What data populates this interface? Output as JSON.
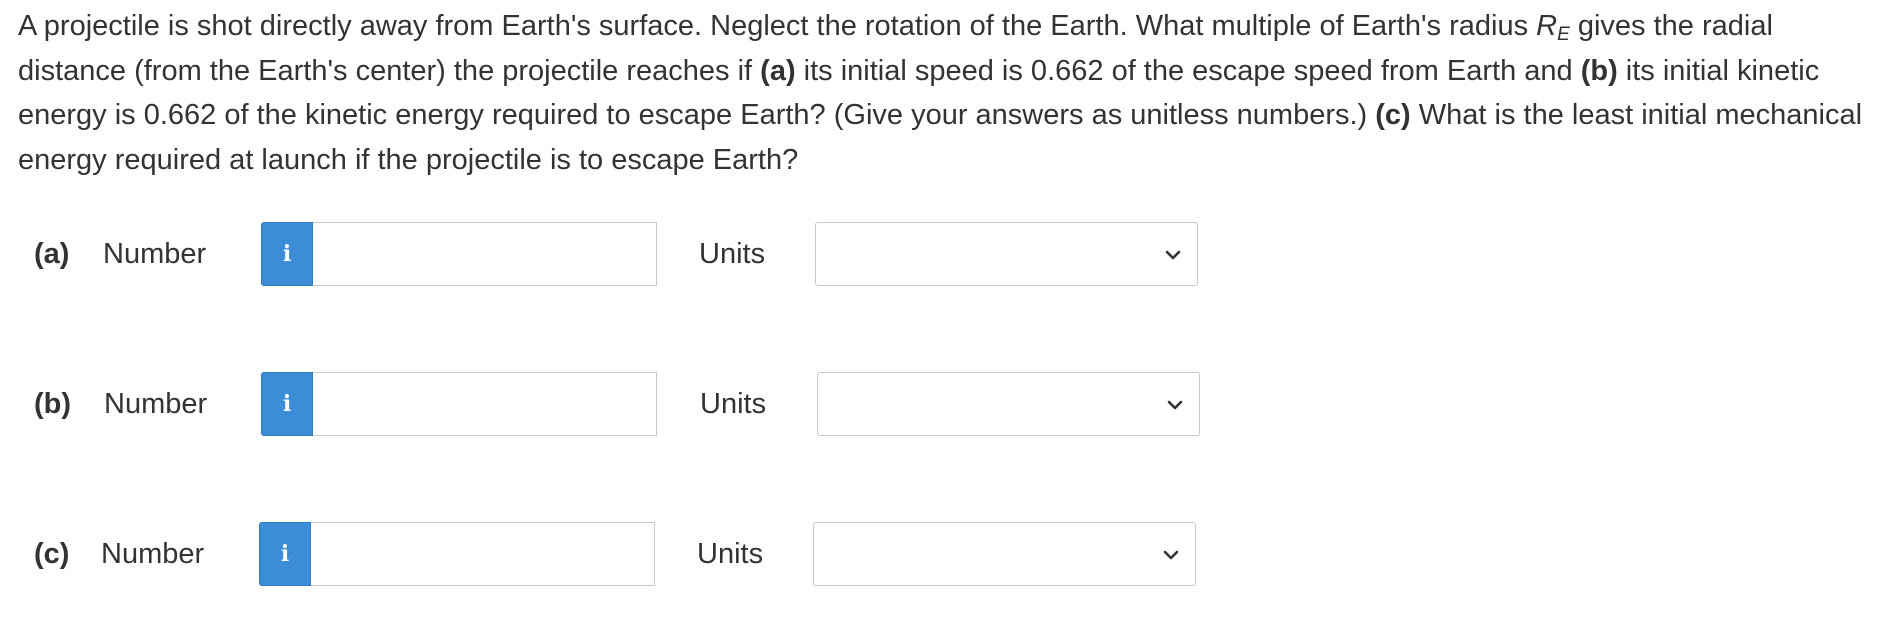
{
  "question": {
    "intro": "A projectile is shot directly away from Earth's surface. Neglect the rotation of the Earth. What multiple of Earth's radius ",
    "symbol": "R",
    "subscript": "E",
    "mid1": " gives the radial distance (from the Earth's center) the projectile reaches if ",
    "part_a": "(a)",
    "mid2": " its initial speed is 0.662 of the escape speed from Earth and ",
    "part_b": "(b)",
    "mid3": " its initial kinetic energy is 0.662 of the kinetic energy required to escape Earth? (Give your answers as unitless numbers.) ",
    "part_c": "(c)",
    "mid4": " What is the least initial mechanical energy required at launch if the projectile is to escape Earth?"
  },
  "rows": [
    {
      "label": "(a)",
      "number_label": "Number",
      "info_glyph": "i",
      "value": "",
      "units_label": "Units",
      "units_value": ""
    },
    {
      "label": "(b)",
      "number_label": "Number",
      "info_glyph": "i",
      "value": "",
      "units_label": "Units",
      "units_value": ""
    },
    {
      "label": "(c)",
      "number_label": "Number",
      "info_glyph": "i",
      "value": "",
      "units_label": "Units",
      "units_value": ""
    }
  ],
  "icons": {
    "info": "info-icon",
    "dropdown": "chevron-down-icon"
  },
  "colors": {
    "info_button": "#3d8cd8",
    "text": "#333333",
    "border": "#c8c8c8"
  }
}
